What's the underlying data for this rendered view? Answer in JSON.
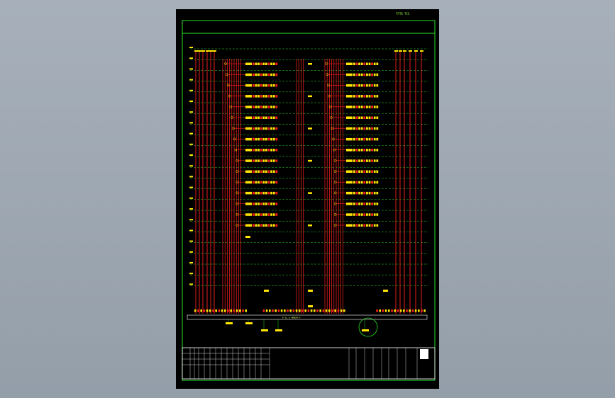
{
  "drawing": {
    "header_label": "TFTR TC5",
    "bus_label": "P  SL U  HMB5M P"
  },
  "colors": {
    "background": "#9fa8b3",
    "sheet": "#000000",
    "frame": "#27e327",
    "bus": "#ff2020",
    "device": "#ffe600",
    "dash": "#2bd42b",
    "title_block": "#ffffff"
  },
  "diagram": {
    "row_count": 23,
    "block_rows": 16,
    "left_bus_count": 6,
    "right_bus_count": 6,
    "callout_circle": "detail-callout"
  }
}
